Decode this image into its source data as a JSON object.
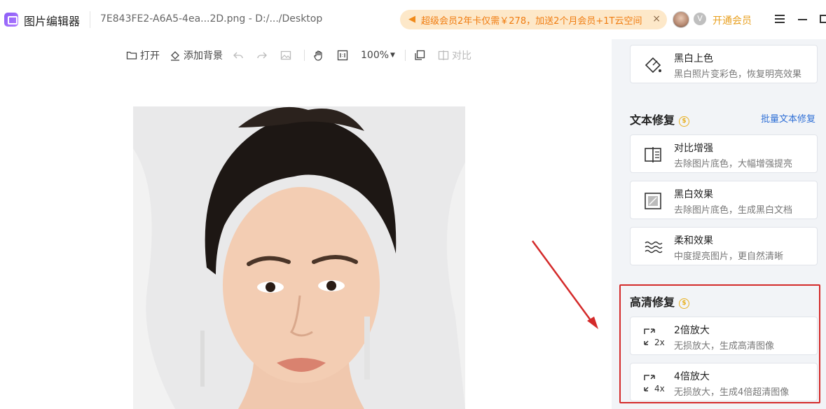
{
  "app": {
    "name": "图片编辑器",
    "file": "7E843FE2-A6A5-4ea...2D.png - D:/.../Desktop"
  },
  "promo": {
    "text": "超级会员2年卡仅需￥278，加送2个月会员+1T云空间",
    "close": "×"
  },
  "account": {
    "vip_label": "开通会员"
  },
  "toolbar": {
    "open_label": "打开",
    "add_bg_label": "添加背景",
    "zoom": "100%",
    "compare_label": "对比"
  },
  "panel": {
    "top_card": {
      "title": "黑白上色",
      "desc": "黑白照片变彩色，恢复明亮效果",
      "icon": "bucket-icon"
    },
    "text_repair": {
      "title": "文本修复",
      "link": "批量文本修复",
      "cards": [
        {
          "title": "对比增强",
          "desc": "去除图片底色，大幅增强提亮",
          "icon": "contrast-icon"
        },
        {
          "title": "黑白效果",
          "desc": "去除图片底色，生成黑白文档",
          "icon": "bw-doc-icon"
        },
        {
          "title": "柔和效果",
          "desc": "中度提亮图片，更自然清晰",
          "icon": "wave-icon"
        }
      ]
    },
    "hd_repair": {
      "title": "高清修复",
      "cards": [
        {
          "title": "2倍放大",
          "desc": "无损放大，生成高清图像",
          "icon": "upscale-2x-icon",
          "badge": "2x"
        },
        {
          "title": "4倍放大",
          "desc": "无损放大，生成4倍超清图像",
          "icon": "upscale-4x-icon",
          "badge": "4x"
        }
      ]
    }
  },
  "colors": {
    "accent": "#8a5cf6",
    "promo_bg": "#fde8c9",
    "promo_text": "#f07c10",
    "vip": "#e8a020",
    "link": "#2f6fd6",
    "highlight": "#d42a2a",
    "panel_bg": "#f2f4f7"
  }
}
